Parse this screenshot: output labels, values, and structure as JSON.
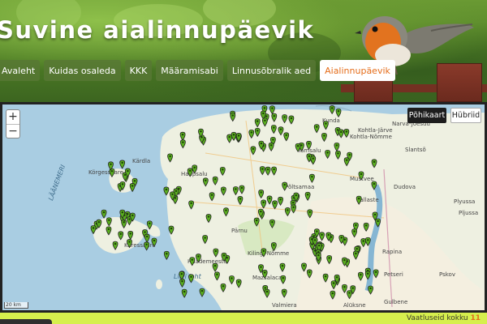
{
  "site": {
    "title": "Suvine aialinnupäevik"
  },
  "nav": {
    "items": [
      {
        "label": "Avaleht"
      },
      {
        "label": "Kuidas osaleda"
      },
      {
        "label": "KKK"
      },
      {
        "label": "Määramisabi"
      },
      {
        "label": "Linnusõbralik aed"
      },
      {
        "label": "Aialinnupäevik",
        "active": true
      }
    ]
  },
  "map": {
    "zoom_in": "+",
    "zoom_out": "−",
    "map_types": [
      "Põhikaart",
      "Hübriid"
    ],
    "scale": "20 km",
    "sea_labels": [
      "LÄÄNEMERI",
      "Liivi laht"
    ],
    "place_labels": [
      "Kunda",
      "Narva-Jõesuu",
      "Kohtla-Järve",
      "Kohtla-Nõmme",
      "Slantsõ",
      "Tamsalu",
      "Haapsalu",
      "Kärdla",
      "Körgessaare",
      "Pärnu",
      "Kuressaare",
      "Kilingi-Nõmme",
      "Häädemeeste",
      "Mustvee",
      "Kallaste",
      "Põltsamaa",
      "Rapina",
      "Petseri",
      "Pskov",
      "Mazsalaca",
      "Valmiera",
      "Alūksne",
      "Gulbene",
      "Dudova",
      "Plyussa",
      "Pljussa"
    ],
    "marker_color": "#5aaf1f"
  },
  "footer": {
    "text": "Vaatluseid kokku",
    "count": "11"
  }
}
